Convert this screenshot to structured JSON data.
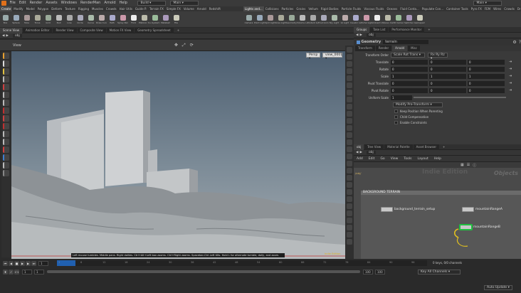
{
  "menubar": {
    "items": [
      "File",
      "Edit",
      "Render",
      "Assets",
      "Windows",
      "RenderMan",
      "Arnold",
      "Help"
    ],
    "build_label": "Build",
    "desktop_left": "Main",
    "desktop_right": "Main"
  },
  "shelf_tabs_left": [
    "Create",
    "Modify",
    "Model",
    "Polygon",
    "Deform",
    "Texture",
    "Rigging",
    "Muscles",
    "Crowds",
    "Hair Utils",
    "Guide P.",
    "Terrain FX",
    "Simple FX",
    "Volume",
    "Arnold",
    "Redshift"
  ],
  "shelf_tabs_right": [
    "Lights and...",
    "Collisions",
    "Particles",
    "Grains",
    "Vellum",
    "Rigid Bodies",
    "Particle Fluids",
    "Viscous Fluids",
    "Oceans",
    "Fluid Conta...",
    "Populate Con...",
    "Container Tools",
    "Pyro FX",
    "FEM",
    "Wires",
    "Crowds",
    "Drive Simula..."
  ],
  "shelf_tools_left": [
    "Box",
    "Sphere",
    "Tube",
    "Torus",
    "Grid",
    "Null",
    "Line",
    "Circle",
    "Curve",
    "Draw Curve",
    "Path",
    "Spray Paint",
    "Font",
    "Platonic Solids",
    "L-System",
    "Metaball",
    "File"
  ],
  "shelf_tools_right": [
    "Camera",
    "Point Light",
    "Spot Light",
    "Area Light",
    "Geometry Light",
    "Volume Light",
    "Distant Light",
    "Environment Light",
    "Sky Light",
    "GI Light",
    "Caustic Light",
    "Portal Light",
    "Ambient Light",
    "Stereo Camera",
    "VR Camera",
    "Switcher",
    "Gamepad Camera"
  ],
  "viewer_tabs": [
    "Scene View",
    "Animation Editor",
    "Render View",
    "Composite View",
    "Motion FX View",
    "Geometry Spreadsheet"
  ],
  "viewer": {
    "path": "obj",
    "title": "View",
    "persp": "Persp",
    "cam": "view_0001",
    "hint": "Left mouse tumbles. Middle pans. Right dollies. Ctrl+Alt+Left box zooms. Ctrl+Right zooms. Spacebar-Ctrl-Left tilts. Hold L for alternate tumble, dolly, and zoom.",
    "indie": "Indie Edition"
  },
  "param_tabs": [
    "Groups",
    "Take List",
    "Performance Monitor"
  ],
  "params": {
    "path": "obj",
    "node_type": "Geometry",
    "node_name": "terrain",
    "sub_tabs": [
      "Transform",
      "Render",
      "Arnold",
      "Misc"
    ],
    "transform_order_label": "Transform Order",
    "transform_order": "Scale Rot Trans",
    "rotate_order": "Rx Ry Rz",
    "rows": [
      {
        "label": "Translate",
        "values": [
          "0",
          "0",
          "0"
        ]
      },
      {
        "label": "Rotate",
        "values": [
          "0",
          "0",
          "0"
        ]
      },
      {
        "label": "Scale",
        "values": [
          "1",
          "1",
          "1"
        ]
      },
      {
        "label": "Pivot Translate",
        "values": [
          "0",
          "0",
          "0"
        ]
      },
      {
        "label": "Pivot Rotate",
        "values": [
          "0",
          "0",
          "0"
        ]
      }
    ],
    "uniform_label": "Uniform Scale",
    "uniform_value": "1",
    "modify_label": "Modify Pre-Transform",
    "checks": [
      "Keep Position When Parenting",
      "Child Compensation",
      "Enable Constraints"
    ]
  },
  "network_tabs": [
    "obj",
    "Tree View",
    "Material Palette",
    "Asset Browser"
  ],
  "network": {
    "path": "obj",
    "menu": [
      "Add",
      "Edit",
      "Go",
      "View",
      "Tools",
      "Layout",
      "Help"
    ],
    "watermark": "Indie Edition",
    "context": "Objects",
    "net_label": "/obj/",
    "network_box": "BACKGROUND TERRAIN",
    "nodes": [
      "background_terrain_setup",
      "mountainRangeA",
      "mountainRangeB"
    ]
  },
  "timeline": {
    "frame": "1",
    "start": "1",
    "end": "1",
    "range_end": "100",
    "range_end2": "100",
    "keys_label": "0 keys, 0/0 channels",
    "key_mode": "Key All Channels",
    "auto_update": "Auto Update",
    "ticks": [
      "1",
      "6",
      "12",
      "18",
      "24",
      "30",
      "36",
      "42",
      "48",
      "54",
      "60",
      "66",
      "72",
      "78",
      "84",
      "90",
      "96"
    ]
  },
  "colors": {
    "accent": "#f0a020",
    "selected": "#2080ff",
    "node_green": "#20c040"
  }
}
